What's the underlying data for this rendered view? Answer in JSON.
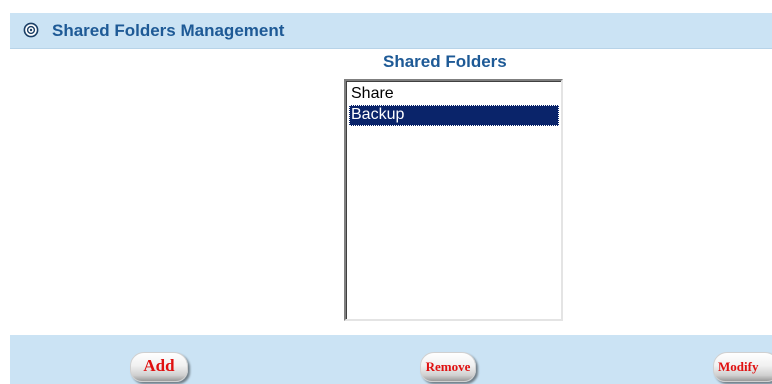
{
  "panel": {
    "title": "Shared Folders Management",
    "icon": "target-circle-icon"
  },
  "folders": {
    "title": "Shared Folders",
    "items": [
      {
        "label": "Share",
        "selected": false
      },
      {
        "label": "Backup",
        "selected": true
      }
    ]
  },
  "actions": {
    "add_label": "Add",
    "remove_label": "Remove",
    "modify_label": "Modify"
  },
  "colors": {
    "header_background": "#cbe3f4",
    "title_text": "#1e5a96",
    "selection": "#0a246a",
    "button_text": "#e01010"
  }
}
